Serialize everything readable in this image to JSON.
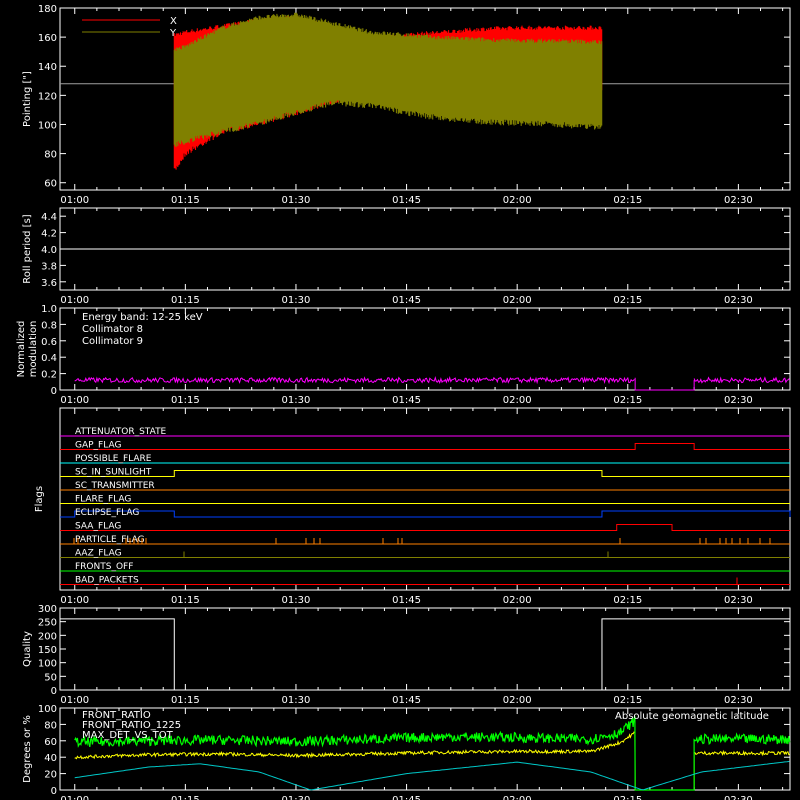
{
  "colors": {
    "background": "#000000",
    "axis": "#ffffff",
    "x_series": "#ff0000",
    "y_series": "#808000",
    "mod8": "#00ffff",
    "mod9": "#ff00ff",
    "ratio": "#ffff00",
    "ratio1225": "#00ff00",
    "maxdet": "#ff8000",
    "geomag": "#00c8c8"
  },
  "time_ticks": [
    "01:00",
    "01:15",
    "01:30",
    "01:45",
    "02:00",
    "02:15",
    "02:30"
  ],
  "chart_data": [
    {
      "type": "line",
      "panel": "pointing",
      "ylabel": "Pointing [\"]",
      "ylim": [
        55,
        180
      ],
      "yticks": [
        60,
        80,
        100,
        120,
        140,
        160,
        180
      ],
      "legend": [
        "X",
        "Y"
      ],
      "data_start": "01:13:30",
      "data_end": "02:11:30",
      "reference_line": 128,
      "series": [
        {
          "name": "X",
          "x": [
            "01:13:30",
            "01:15",
            "01:20",
            "01:25",
            "01:30",
            "01:35",
            "01:40",
            "01:45",
            "01:50",
            "01:55",
            "02:00",
            "02:05",
            "02:11:30"
          ],
          "upper": [
            160,
            162,
            166,
            170,
            172,
            165,
            158,
            160,
            162,
            164,
            165,
            165,
            165
          ],
          "lower": [
            70,
            82,
            97,
            103,
            110,
            118,
            122,
            124,
            128,
            130,
            130,
            128,
            127
          ]
        },
        {
          "name": "Y",
          "x": [
            "01:13:30",
            "01:15",
            "01:20",
            "01:25",
            "01:30",
            "01:35",
            "01:40",
            "01:45",
            "01:50",
            "01:55",
            "02:00",
            "02:05",
            "02:11:30"
          ],
          "upper": [
            150,
            152,
            165,
            172,
            174,
            168,
            162,
            160,
            158,
            157,
            156,
            156,
            155
          ],
          "lower": [
            88,
            90,
            97,
            103,
            110,
            117,
            115,
            110,
            106,
            104,
            103,
            102,
            100
          ]
        }
      ]
    },
    {
      "type": "line",
      "panel": "roll",
      "ylabel": "Roll period [s]",
      "ylim": [
        3.5,
        4.5
      ],
      "yticks": [
        "3.6",
        "3.8",
        "4.0",
        "4.2",
        "4.4"
      ],
      "value": 4.0
    },
    {
      "type": "line",
      "panel": "modulation",
      "ylabel": "Normalized modulation",
      "ylim": [
        0,
        1
      ],
      "yticks": [
        "0",
        "0.2",
        "0.4",
        "0.6",
        "0.8",
        "1.0"
      ],
      "legend": [
        "Energy band: 12-25 keV",
        "Collimator 8",
        "Collimator 9"
      ],
      "segments": [
        {
          "start": "01:00",
          "end": "02:16",
          "level": 0.12
        },
        {
          "start": "02:24",
          "end": "02:37",
          "level": 0.12
        }
      ]
    },
    {
      "type": "table",
      "panel": "flags",
      "ylabel": "Flags",
      "flags": [
        {
          "name": "ATTENUATOR_STATE",
          "color": "#ff00ff",
          "steps": []
        },
        {
          "name": "GAP_FLAG",
          "color": "#ff0000",
          "steps": [
            [
              "02:16",
              "02:24"
            ]
          ]
        },
        {
          "name": "POSSIBLE_FLARE",
          "color": "#00ffff",
          "steps": []
        },
        {
          "name": "SC_IN_SUNLIGHT",
          "color": "#ffff00",
          "steps": [
            [
              "01:13:30",
              "02:11:30"
            ]
          ]
        },
        {
          "name": "SC_TRANSMITTER",
          "color": "#ff8000",
          "steps": []
        },
        {
          "name": "FLARE_FLAG",
          "color": "#ffff00",
          "steps": []
        },
        {
          "name": "ECLIPSE_FLAG",
          "color": "#0040ff",
          "steps": [
            [
              "01:00",
              "01:13:30"
            ],
            [
              "02:11:30",
              "02:37"
            ]
          ]
        },
        {
          "name": "SAA_FLAG",
          "color": "#ff0000",
          "steps": [
            [
              "02:13:30",
              "02:21"
            ]
          ]
        },
        {
          "name": "PARTICLE_FLAG",
          "color": "#ff8000",
          "steps": []
        },
        {
          "name": "AAZ_FLAG",
          "color": "#808000",
          "steps": []
        },
        {
          "name": "FRONTS_OFF",
          "color": "#00ff00",
          "steps": []
        },
        {
          "name": "BAD_PACKETS",
          "color": "#ff0000",
          "steps": []
        }
      ]
    },
    {
      "type": "line",
      "panel": "quality",
      "ylabel": "Quality",
      "ylim": [
        0,
        300
      ],
      "yticks": [
        "0",
        "50",
        "100",
        "150",
        "200",
        "250",
        "300"
      ],
      "steps": [
        {
          "start": "01:00",
          "end": "01:13:30",
          "value": 260
        },
        {
          "start": "01:13:30",
          "end": "02:11:30",
          "value": 0
        },
        {
          "start": "02:11:30",
          "end": "02:37",
          "value": 260
        }
      ]
    },
    {
      "type": "line",
      "panel": "ratios",
      "ylabel": "Degrees or %",
      "ylim": [
        0,
        100
      ],
      "yticks": [
        "0",
        "20",
        "40",
        "60",
        "80",
        "100"
      ],
      "legend": [
        "FRONT_RATIO",
        "FRONT_RATIO_1225",
        "MAX_DET_VS_TOT"
      ],
      "annotation": "Absolute geomagnetic latitude",
      "gap": [
        "02:16",
        "02:24"
      ],
      "series": [
        {
          "name": "FRONT_RATIO",
          "x": [
            "01:00",
            "01:10",
            "01:20",
            "01:30",
            "01:40",
            "01:50",
            "02:00",
            "02:10",
            "02:14",
            "02:16"
          ],
          "values": [
            40,
            43,
            44,
            42,
            44,
            46,
            47,
            47,
            58,
            70
          ]
        },
        {
          "name": "FRONT_RATIO_1225",
          "x": [
            "01:00",
            "01:10",
            "01:20",
            "01:30",
            "01:40",
            "01:50",
            "02:00",
            "02:10",
            "02:14",
            "02:16"
          ],
          "values": [
            58,
            60,
            61,
            59,
            62,
            65,
            64,
            62,
            70,
            85
          ]
        },
        {
          "name": "Absolute geomagnetic latitude",
          "x": [
            "01:00",
            "01:10",
            "01:17",
            "01:25",
            "01:32",
            "01:45",
            "02:00",
            "02:10",
            "02:17",
            "02:25",
            "02:37"
          ],
          "values": [
            15,
            28,
            32,
            22,
            0,
            20,
            34,
            22,
            0,
            22,
            35
          ]
        }
      ],
      "after_gap": {
        "FRONT_RATIO": 45,
        "FRONT_RATIO_1225": 62
      }
    }
  ]
}
